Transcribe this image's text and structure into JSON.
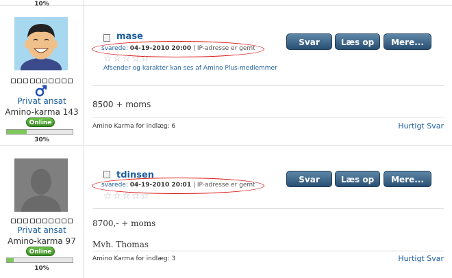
{
  "top_strip": {
    "pct": "10%"
  },
  "posts": [
    {
      "username": "mase",
      "replied_label": "svarede:",
      "timestamp": "04-19-2010 20:00",
      "ip_note": "| IP-adresse er gemt",
      "notice": "Afsender og karakter kan ses af Amino Plus-medlemmer",
      "body": [
        "8500 + moms"
      ],
      "footer_left": "Amino Karma for indlæg: 6",
      "footer_right": "Hurtigt Svar",
      "buttons": {
        "reply": "Svar",
        "read": "Læs op",
        "more": "Mere..."
      },
      "user": {
        "role": "Privat ansat",
        "karma": "Amino-karma 143",
        "status": "Online",
        "progress": 0.3,
        "pct": "30%"
      }
    },
    {
      "username": "tdinsen",
      "replied_label": "svarede:",
      "timestamp": "04-19-2010 20:01",
      "ip_note": "| IP-adresse er gemt",
      "body": [
        "8700,- + moms",
        "Mvh. Thomas"
      ],
      "footer_left": "Amino Karma for indlæg: 3",
      "footer_right": "Hurtigt Svar",
      "buttons": {
        "reply": "Svar",
        "read": "Læs op",
        "more": "Mere..."
      },
      "user": {
        "role": "Privat ansat",
        "karma": "Amino-karma 97",
        "status": "Online",
        "progress": 0.1,
        "pct": "10%"
      }
    }
  ]
}
